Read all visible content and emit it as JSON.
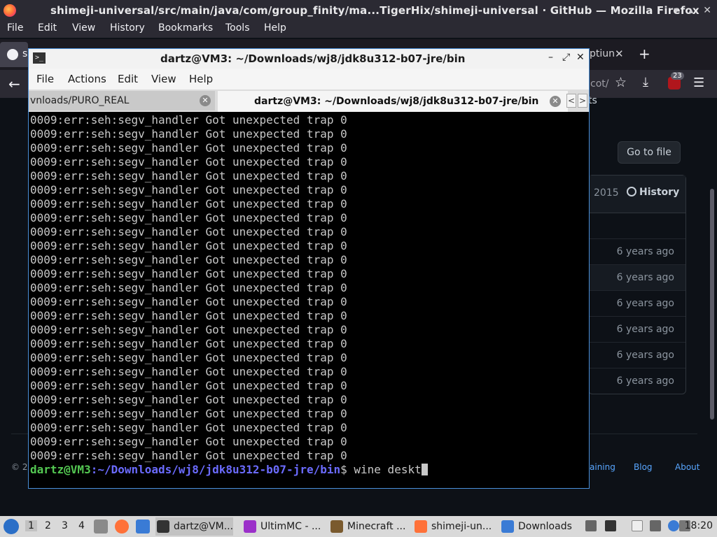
{
  "firefox": {
    "window_title": "shimeji-universal/src/main/java/com/group_finity/ma...TigerHix/shimeji-universal · GitHub — Mozilla Firefox",
    "menu": [
      "File",
      "Edit",
      "View",
      "History",
      "Bookmarks",
      "Tools",
      "Help"
    ],
    "tab_left_label": "s",
    "tab_right_label": "ptiun",
    "close_glyph": "✕",
    "new_tab_glyph": "+",
    "url_fragment": "cot/",
    "downloads_badge": "23"
  },
  "github": {
    "go_to_file": "Go to file",
    "year_fragment": "2015",
    "history_label": "History",
    "rows": [
      "6 years ago",
      "6 years ago",
      "6 years ago",
      "6 years ago",
      "6 years ago",
      "6 years ago"
    ],
    "footer_left": "© 20",
    "footer_links": [
      "aining",
      "Blog",
      "About"
    ],
    "tab_hint": "ts"
  },
  "terminal": {
    "title": "dartz@VM3: ~/Downloads/wj8/jdk8u312-b07-jre/bin",
    "menu": [
      "File",
      "Actions",
      "Edit",
      "View",
      "Help"
    ],
    "tab_inactive": "vnloads/PURO_REAL",
    "tab_active": "dartz@VM3: ~/Downloads/wj8/jdk8u312-b07-jre/bin",
    "lines": [
      "0009:err:seh:segv_handler Got unexpected trap 0",
      "0009:err:seh:segv_handler Got unexpected trap 0",
      "0009:err:seh:segv_handler Got unexpected trap 0",
      "0009:err:seh:segv_handler Got unexpected trap 0",
      "0009:err:seh:segv_handler Got unexpected trap 0",
      "0009:err:seh:segv_handler Got unexpected trap 0",
      "0009:err:seh:segv_handler Got unexpected trap 0",
      "0009:err:seh:segv_handler Got unexpected trap 0",
      "0009:err:seh:segv_handler Got unexpected trap 0",
      "0009:err:seh:segv_handler Got unexpected trap 0",
      "0009:err:seh:segv_handler Got unexpected trap 0",
      "0009:err:seh:segv_handler Got unexpected trap 0",
      "0009:err:seh:segv_handler Got unexpected trap 0",
      "0009:err:seh:segv_handler Got unexpected trap 0",
      "0009:err:seh:segv_handler Got unexpected trap 0",
      "0009:err:seh:segv_handler Got unexpected trap 0",
      "0009:err:seh:segv_handler Got unexpected trap 0",
      "0009:err:seh:segv_handler Got unexpected trap 0",
      "0009:err:seh:segv_handler Got unexpected trap 0",
      "0009:err:seh:segv_handler Got unexpected trap 0",
      "0009:err:seh:segv_handler Got unexpected trap 0",
      "0009:err:seh:segv_handler Got unexpected trap 0",
      "0009:err:seh:segv_handler Got unexpected trap 0",
      "0009:err:seh:segv_handler Got unexpected trap 0",
      "0009:err:seh:segv_handler Got unexpected trap 0"
    ],
    "prompt_user": "dartz@VM3",
    "prompt_path": ":~/Downloads/wj8/jdk8u312-b07-jre/bin",
    "prompt_symbol": "$ ",
    "command": "wine deskt"
  },
  "taskbar": {
    "workspaces": [
      "1",
      "2",
      "3",
      "4"
    ],
    "tasks": [
      {
        "label": "dartz@VM...",
        "icon": "terminal-icon",
        "color": "#333333"
      },
      {
        "label": "UltimMC - ...",
        "icon": "ultimmc-icon",
        "color": "#9b30c9"
      },
      {
        "label": "Minecraft ...",
        "icon": "minecraft-icon",
        "color": "#7a5a2e"
      },
      {
        "label": "shimeji-un...",
        "icon": "firefox-icon",
        "color": "#ff7139"
      },
      {
        "label": "Downloads",
        "icon": "folder-icon",
        "color": "#3a7bd5"
      }
    ],
    "clock": "18:20"
  }
}
